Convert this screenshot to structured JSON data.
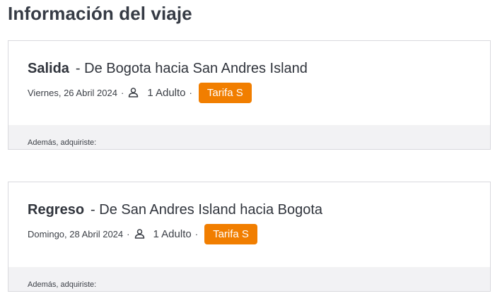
{
  "page": {
    "title": "Información del viaje"
  },
  "trips": [
    {
      "leg_type": "Salida",
      "route": "- De Bogota hacia San Andres Island",
      "date": "Viernes, 26 Abril 2024",
      "passengers": "1 Adulto",
      "fare": "Tarifa S",
      "extras_label": "Además, adquiriste:"
    },
    {
      "leg_type": "Regreso",
      "route": "- De San Andres Island hacia Bogota",
      "date": "Domingo, 28 Abril 2024",
      "passengers": "1 Adulto",
      "fare": "Tarifa S",
      "extras_label": "Además, adquiriste:"
    }
  ],
  "separator": "·",
  "icons": {
    "passenger": "person-icon"
  },
  "colors": {
    "fare_badge": "#f17e00",
    "extras_background": "#f2f2f4"
  }
}
